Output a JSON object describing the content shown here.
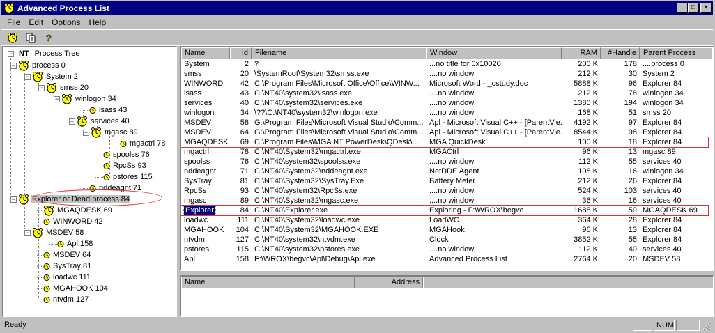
{
  "window": {
    "title": "Advanced Process List"
  },
  "titlebar_buttons": {
    "minimize": "_",
    "maximize": "□",
    "close": "×"
  },
  "menu": [
    {
      "label": "File",
      "key": "F",
      "rest": "ile"
    },
    {
      "label": "Edit",
      "key": "E",
      "rest": "dit"
    },
    {
      "label": "Options",
      "key": "O",
      "rest": "ptions"
    },
    {
      "label": "Help",
      "key": "H",
      "rest": "elp"
    }
  ],
  "toolbar": [
    {
      "icon": "refresh-clock-icon"
    },
    {
      "icon": "copy-icon"
    },
    {
      "icon": "help-icon"
    }
  ],
  "tree": {
    "root": {
      "prefix": "NT",
      "label": "Process Tree"
    },
    "nodes": [
      {
        "label": "process 0"
      },
      {
        "label": "System 2"
      },
      {
        "label": "smss 20"
      },
      {
        "label": "winlogon 34"
      },
      {
        "label": "lsass 43"
      },
      {
        "label": "services 40"
      },
      {
        "label": "mgasc 89"
      },
      {
        "label": "mgactrl 78"
      },
      {
        "label": "spoolss 76"
      },
      {
        "label": "RpcSs 93"
      },
      {
        "label": "pstores 115"
      },
      {
        "label": "nddeagnt 71"
      },
      {
        "label": "Explorer or Dead process 84"
      },
      {
        "label": "MGAQDESK 69"
      },
      {
        "label": "WINWORD 42"
      },
      {
        "label": "MSDEV 58"
      },
      {
        "label": "Apl 158"
      },
      {
        "label": "MSDEV 64"
      },
      {
        "label": "SysTray 81"
      },
      {
        "label": "loadwc 111"
      },
      {
        "label": "MGAHOOK 104"
      },
      {
        "label": "ntvdm 127"
      }
    ]
  },
  "list": {
    "columns": [
      "Name",
      "Id",
      "Filename",
      "Window",
      "RAM",
      "#Handle",
      "Parent Process"
    ],
    "rows": [
      [
        "System",
        "2",
        "?",
        "...no title for 0x10020",
        "200 K",
        "178",
        "....process 0"
      ],
      [
        "smss",
        "20",
        "\\SystemRoot\\System32\\smss.exe",
        "....no window",
        "212 K",
        "30",
        "System 2"
      ],
      [
        "WINWORD",
        "42",
        "C:\\Program Files\\Microsoft Office\\Office\\WINW...",
        "Microsoft Word - _cstudy.doc",
        "5888 K",
        "96",
        "Explorer 84"
      ],
      [
        "lsass",
        "43",
        "C:\\NT40\\system32\\lsass.exe",
        "....no window",
        "212 K",
        "78",
        "winlogon 34"
      ],
      [
        "services",
        "40",
        "C:\\NT40\\system32\\services.exe",
        "....no window",
        "1380 K",
        "194",
        "winlogon 34"
      ],
      [
        "winlogon",
        "34",
        "\\??\\C:\\NT40\\system32\\winlogon.exe",
        "....no window",
        "168 K",
        "51",
        "smss 20"
      ],
      [
        "MSDEV",
        "58",
        "G:\\Program Files\\Microsoft Visual Studio\\Comm...",
        "Apl - Microsoft Visual C++ - [ParentVie...",
        "4192 K",
        "97",
        "Explorer 84"
      ],
      [
        "MSDEV",
        "64",
        "G:\\Program Files\\Microsoft Visual Studio\\Comm...",
        "Apl - Microsoft Visual C++ - [ParentVie...",
        "8544 K",
        "98",
        "Explorer 84"
      ],
      [
        "MGAQDESK",
        "69",
        "C:\\Program Files\\MGA NT PowerDesk\\QDesk\\...",
        "MGA QuickDesk",
        "100 K",
        "18",
        "Explorer 84"
      ],
      [
        "mgactrl",
        "78",
        "C:\\NT40\\System32\\mgactrl.exe",
        "MGACtrl",
        "96 K",
        "13",
        "mgasc 89"
      ],
      [
        "spoolss",
        "76",
        "C:\\NT40\\system32\\spoolss.exe",
        "....no window",
        "112 K",
        "55",
        "services 40"
      ],
      [
        "nddeagnt",
        "71",
        "C:\\NT40\\System32\\nddeagnt.exe",
        "NetDDE Agent",
        "108 K",
        "16",
        "winlogon 34"
      ],
      [
        "SysTray",
        "81",
        "C:\\NT40\\System32\\SysTray.Exe",
        "Battery Meter",
        "212 K",
        "26",
        "Explorer 84"
      ],
      [
        "RpcSs",
        "93",
        "C:\\NT40\\system32\\RpcSs.exe",
        "....no window",
        "524 K",
        "103",
        "services 40"
      ],
      [
        "mgasc",
        "89",
        "C:\\NT40\\System32\\mgasc.exe",
        "....no window",
        "36 K",
        "16",
        "services 40"
      ],
      [
        "Explorer",
        "84",
        "C:\\NT40\\Explorer.exe",
        "Exploring - F:\\WROX\\begvc",
        "1688 K",
        "59",
        "MGAQDESK 69"
      ],
      [
        "loadwc",
        "111",
        "C:\\NT40\\System32\\loadwc.exe",
        "LoadWC",
        "364 K",
        "28",
        "Explorer 84"
      ],
      [
        "MGAHOOK",
        "104",
        "C:\\NT40\\System32\\MGAHOOK.EXE",
        "MGAHook",
        "96 K",
        "13",
        "Explorer 84"
      ],
      [
        "ntvdm",
        "127",
        "C:\\NT40\\system32\\ntvdm.exe",
        "Clock",
        "3852 K",
        "55",
        "Explorer 84"
      ],
      [
        "pstores",
        "115",
        "C:\\NT40\\system32\\pstores.exe",
        "....no window",
        "112 K",
        "40",
        "services 40"
      ],
      [
        "Apl",
        "158",
        "F:\\WROX\\begvc\\Apl\\Debug\\Apl.exe",
        "Advanced Process List",
        "2764 K",
        "20",
        "MSDEV 58"
      ]
    ]
  },
  "address": {
    "columns": [
      "Name",
      "Address"
    ]
  },
  "status": {
    "text": "Ready",
    "num": "NUM"
  },
  "colors": {
    "title_bg": "#000080",
    "face": "#c0c0c0",
    "highlight_box": "#e03030",
    "icon_yellow": "#ffff00"
  }
}
